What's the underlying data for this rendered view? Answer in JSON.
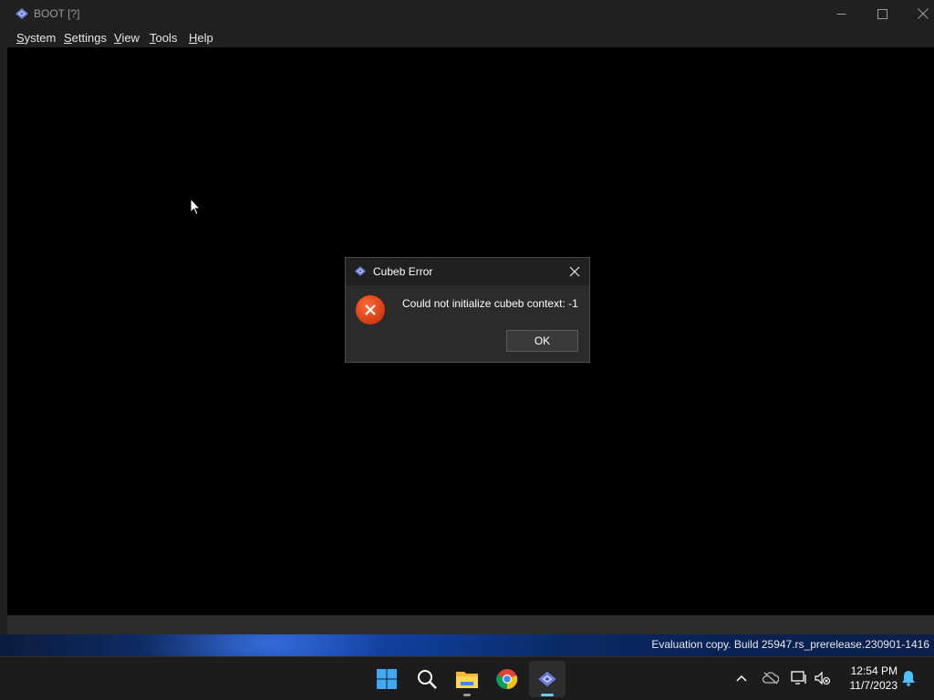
{
  "window": {
    "title": "BOOT [?]",
    "controls": {
      "minimize": "minimize",
      "maximize": "maximize",
      "close": "close"
    }
  },
  "menubar": {
    "items": [
      {
        "label": "System",
        "key": "S",
        "rest": "ystem"
      },
      {
        "label": "Settings",
        "key": "S",
        "rest": "ettings"
      },
      {
        "label": "View",
        "key": "V",
        "rest": "iew"
      },
      {
        "label": "Tools",
        "key": "T",
        "rest": "ools"
      },
      {
        "label": "Help",
        "key": "H",
        "rest": "elp"
      }
    ]
  },
  "dialog": {
    "title": "Cubeb Error",
    "message": "Could not initialize cubeb context: -1",
    "ok_label": "OK",
    "icon": "error-icon"
  },
  "desktop": {
    "watermark": "Evaluation copy. Build 25947.rs_prerelease.230901-1416"
  },
  "taskbar": {
    "apps": [
      "start-icon",
      "search-icon",
      "file-explorer-icon",
      "chrome-icon",
      "app-icon"
    ],
    "clock": {
      "time": "12:54 PM",
      "date": "11/7/2023"
    }
  },
  "colors": {
    "accent": "#60cdff",
    "error": "#d23a10",
    "window_bg": "#202020"
  }
}
